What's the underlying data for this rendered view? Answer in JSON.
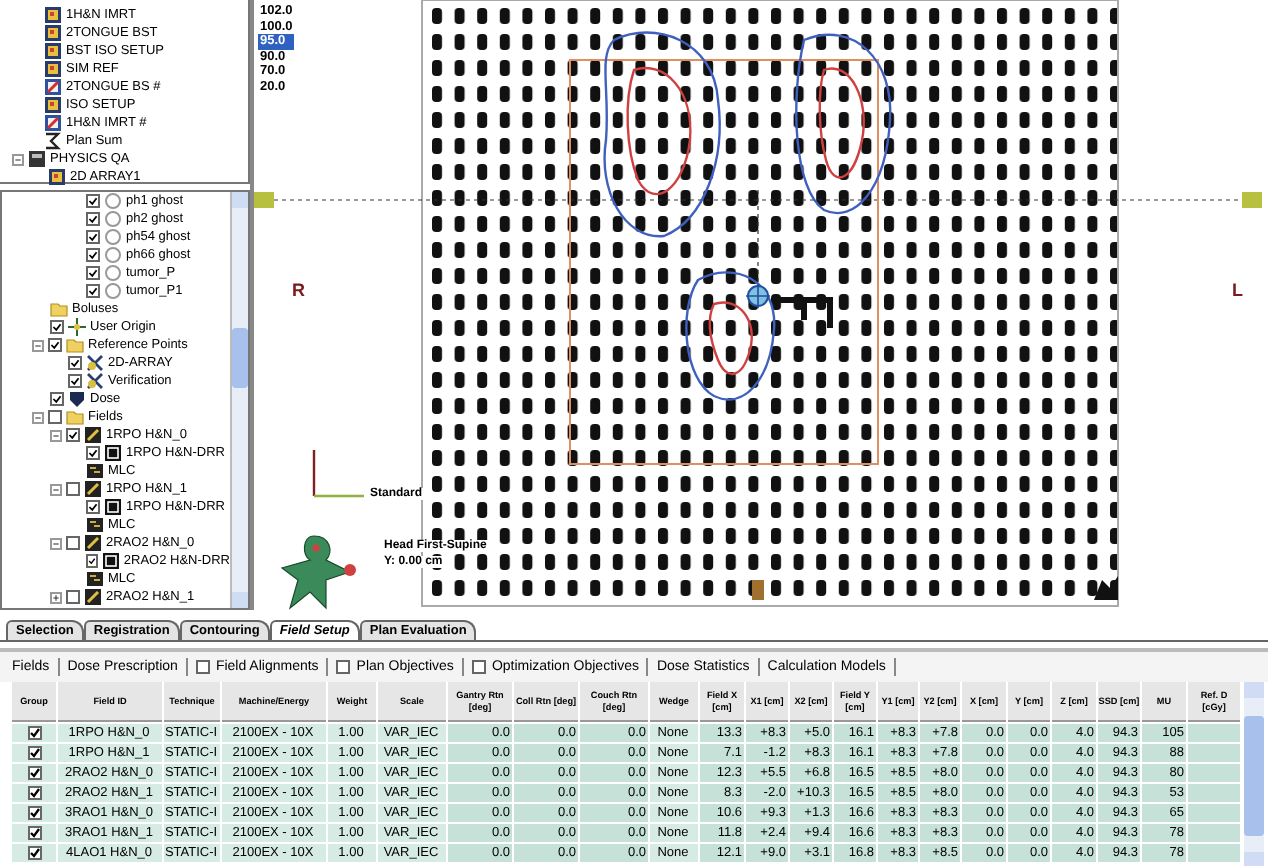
{
  "plan_tree": {
    "plans": [
      {
        "label": "1H&N IMRT",
        "kind": "plan"
      },
      {
        "label": "2TONGUE BST",
        "kind": "plan"
      },
      {
        "label": "BST ISO SETUP",
        "kind": "plan"
      },
      {
        "label": "SIM REF",
        "kind": "plan"
      },
      {
        "label": "2TONGUE BS #",
        "kind": "plan-copy"
      },
      {
        "label": "ISO SETUP",
        "kind": "plan"
      },
      {
        "label": "1H&N IMRT #",
        "kind": "plan-copy"
      },
      {
        "label": "Plan Sum",
        "kind": "plan-sum"
      }
    ],
    "courses": [
      {
        "label": "PHYSICS QA",
        "kind": "course",
        "expanded": true,
        "children": [
          {
            "label": "2D ARRAY1",
            "kind": "plan"
          }
        ]
      }
    ]
  },
  "isodose_legend": [
    {
      "value": "102.0",
      "selected": false
    },
    {
      "value": "100.0",
      "selected": false
    },
    {
      "value": "95.0",
      "selected": true
    },
    {
      "value": "90.0",
      "selected": false
    },
    {
      "value": "70.0",
      "selected": false
    },
    {
      "value": "20.0",
      "selected": false
    }
  ],
  "structure_tree": {
    "structures": [
      {
        "label": "ph1 ghost",
        "kind": "structure",
        "checked": true
      },
      {
        "label": "ph2 ghost",
        "kind": "structure",
        "checked": true
      },
      {
        "label": "ph54 ghost",
        "kind": "structure",
        "checked": true
      },
      {
        "label": "ph66 ghost",
        "kind": "structure",
        "checked": true
      },
      {
        "label": "tumor_P",
        "kind": "structure",
        "checked": true
      },
      {
        "label": "tumor_P1",
        "kind": "structure",
        "checked": true
      }
    ],
    "items": [
      {
        "label": "Boluses",
        "kind": "folder"
      },
      {
        "label": "User Origin",
        "kind": "origin",
        "checked": true
      },
      {
        "label": "Reference Points",
        "kind": "folder",
        "checked": true,
        "expanded": true,
        "children": [
          {
            "label": "2D-ARRAY",
            "kind": "point",
            "checked": true
          },
          {
            "label": "Verification",
            "kind": "point",
            "checked": true
          }
        ]
      },
      {
        "label": "Dose",
        "kind": "dose",
        "checked": true
      },
      {
        "label": "Fields",
        "kind": "folder",
        "checked": false,
        "expanded": true,
        "children": [
          {
            "label": "1RPO H&N_0",
            "kind": "field",
            "checked": true,
            "expanded": true,
            "children": [
              {
                "label": "1RPO H&N-DRR",
                "kind": "drr",
                "checked": true
              },
              {
                "label": "MLC",
                "kind": "mlc"
              }
            ]
          },
          {
            "label": "1RPO H&N_1",
            "kind": "field",
            "checked": false,
            "expanded": true,
            "children": [
              {
                "label": "1RPO H&N-DRR",
                "kind": "drr",
                "checked": true
              },
              {
                "label": "MLC",
                "kind": "mlc"
              }
            ]
          },
          {
            "label": "2RAO2 H&N_0",
            "kind": "field",
            "checked": false,
            "expanded": true,
            "children": [
              {
                "label": "2RAO2 H&N-DRR",
                "kind": "drr",
                "checked": true
              },
              {
                "label": "MLC",
                "kind": "mlc"
              }
            ]
          },
          {
            "label": "2RAO2 H&N_1",
            "kind": "field",
            "checked": false,
            "expanded": false
          }
        ]
      }
    ]
  },
  "viewer": {
    "left_label": "R",
    "right_label": "L",
    "axis_label": "Standard",
    "orientation": "Head First-Supine",
    "coordinate": "Y: 0.00 cm"
  },
  "workspace_tabs": [
    {
      "label": "Selection",
      "selected": false
    },
    {
      "label": "Registration",
      "selected": false
    },
    {
      "label": "Contouring",
      "selected": false
    },
    {
      "label": "Field Setup",
      "selected": true
    },
    {
      "label": "Plan Evaluation",
      "selected": false
    }
  ],
  "field_tabs": [
    {
      "label": "Fields"
    },
    {
      "label": "Dose Prescription"
    },
    {
      "label": "Field Alignments",
      "checked": false
    },
    {
      "label": "Plan Objectives",
      "checked": false
    },
    {
      "label": "Optimization Objectives",
      "checked": false
    },
    {
      "label": "Dose Statistics"
    },
    {
      "label": "Calculation Models"
    }
  ],
  "fields_table": {
    "group_column": "Group",
    "columns": [
      "Field ID",
      "Technique",
      "Machine/Energy",
      "Weight",
      "Scale",
      "Gantry Rtn [deg]",
      "Coll Rtn [deg]",
      "Couch Rtn [deg]",
      "Wedge",
      "Field X [cm]",
      "X1 [cm]",
      "X2 [cm]",
      "Field Y [cm]",
      "Y1 [cm]",
      "Y2 [cm]",
      "X [cm]",
      "Y [cm]",
      "Z [cm]",
      "SSD [cm]",
      "MU",
      "Ref. D [cGy]"
    ],
    "rows": [
      {
        "group": true,
        "cells": [
          "1RPO H&N_0",
          "STATIC-I",
          "2100EX - 10X",
          "1.00",
          "VAR_IEC",
          "0.0",
          "0.0",
          "0.0",
          "None",
          "13.3",
          "+8.3",
          "+5.0",
          "16.1",
          "+8.3",
          "+7.8",
          "0.0",
          "0.0",
          "4.0",
          "94.3",
          "105"
        ]
      },
      {
        "group": true,
        "cells": [
          "1RPO H&N_1",
          "STATIC-I",
          "2100EX - 10X",
          "1.00",
          "VAR_IEC",
          "0.0",
          "0.0",
          "0.0",
          "None",
          "7.1",
          "-1.2",
          "+8.3",
          "16.1",
          "+8.3",
          "+7.8",
          "0.0",
          "0.0",
          "4.0",
          "94.3",
          "88"
        ]
      },
      {
        "group": true,
        "cells": [
          "2RAO2 H&N_0",
          "STATIC-I",
          "2100EX - 10X",
          "1.00",
          "VAR_IEC",
          "0.0",
          "0.0",
          "0.0",
          "None",
          "12.3",
          "+5.5",
          "+6.8",
          "16.5",
          "+8.5",
          "+8.0",
          "0.0",
          "0.0",
          "4.0",
          "94.3",
          "80"
        ]
      },
      {
        "group": true,
        "cells": [
          "2RAO2 H&N_1",
          "STATIC-I",
          "2100EX - 10X",
          "1.00",
          "VAR_IEC",
          "0.0",
          "0.0",
          "0.0",
          "None",
          "8.3",
          "-2.0",
          "+10.3",
          "16.5",
          "+8.5",
          "+8.0",
          "0.0",
          "0.0",
          "4.0",
          "94.3",
          "53"
        ]
      },
      {
        "group": true,
        "cells": [
          "3RAO1 H&N_0",
          "STATIC-I",
          "2100EX - 10X",
          "1.00",
          "VAR_IEC",
          "0.0",
          "0.0",
          "0.0",
          "None",
          "10.6",
          "+9.3",
          "+1.3",
          "16.6",
          "+8.3",
          "+8.3",
          "0.0",
          "0.0",
          "4.0",
          "94.3",
          "65"
        ]
      },
      {
        "group": true,
        "cells": [
          "3RAO1 H&N_1",
          "STATIC-I",
          "2100EX - 10X",
          "1.00",
          "VAR_IEC",
          "0.0",
          "0.0",
          "0.0",
          "None",
          "11.8",
          "+2.4",
          "+9.4",
          "16.6",
          "+8.3",
          "+8.3",
          "0.0",
          "0.0",
          "4.0",
          "94.3",
          "78"
        ]
      },
      {
        "group": true,
        "cells": [
          "4LAO1 H&N_0",
          "STATIC-I",
          "2100EX - 10X",
          "1.00",
          "VAR_IEC",
          "0.0",
          "0.0",
          "0.0",
          "None",
          "12.1",
          "+9.0",
          "+3.1",
          "16.8",
          "+8.3",
          "+8.5",
          "0.0",
          "0.0",
          "4.0",
          "94.3",
          "78"
        ]
      }
    ]
  }
}
